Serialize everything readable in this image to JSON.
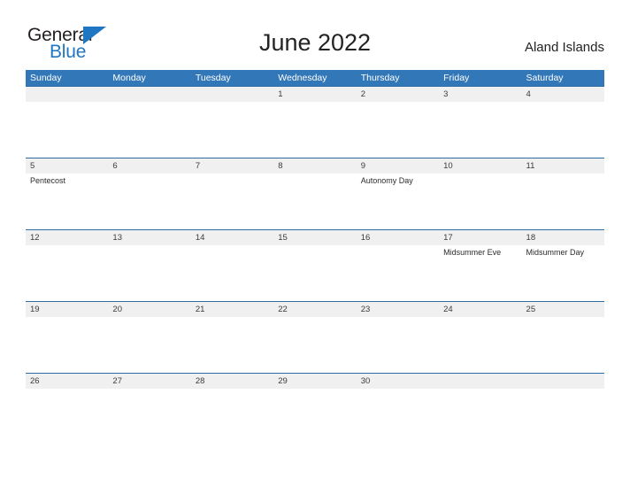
{
  "brand": {
    "name_top": "General",
    "name_bottom": "Blue",
    "accent_color": "#1f76c2"
  },
  "header": {
    "title": "June 2022",
    "locale": "Aland Islands"
  },
  "theme": {
    "header_blue": "#3277b8",
    "row_divider_blue": "#2e6da4",
    "date_band_gray": "#f0f0f0"
  },
  "calendar": {
    "weekdays": [
      "Sunday",
      "Monday",
      "Tuesday",
      "Wednesday",
      "Thursday",
      "Friday",
      "Saturday"
    ],
    "weeks": [
      {
        "days": [
          {
            "date": "",
            "event": ""
          },
          {
            "date": "",
            "event": ""
          },
          {
            "date": "",
            "event": ""
          },
          {
            "date": "1",
            "event": ""
          },
          {
            "date": "2",
            "event": ""
          },
          {
            "date": "3",
            "event": ""
          },
          {
            "date": "4",
            "event": ""
          }
        ]
      },
      {
        "days": [
          {
            "date": "5",
            "event": "Pentecost"
          },
          {
            "date": "6",
            "event": ""
          },
          {
            "date": "7",
            "event": ""
          },
          {
            "date": "8",
            "event": ""
          },
          {
            "date": "9",
            "event": "Autonomy Day"
          },
          {
            "date": "10",
            "event": ""
          },
          {
            "date": "11",
            "event": ""
          }
        ]
      },
      {
        "days": [
          {
            "date": "12",
            "event": ""
          },
          {
            "date": "13",
            "event": ""
          },
          {
            "date": "14",
            "event": ""
          },
          {
            "date": "15",
            "event": ""
          },
          {
            "date": "16",
            "event": ""
          },
          {
            "date": "17",
            "event": "Midsummer Eve"
          },
          {
            "date": "18",
            "event": "Midsummer Day"
          }
        ]
      },
      {
        "days": [
          {
            "date": "19",
            "event": ""
          },
          {
            "date": "20",
            "event": ""
          },
          {
            "date": "21",
            "event": ""
          },
          {
            "date": "22",
            "event": ""
          },
          {
            "date": "23",
            "event": ""
          },
          {
            "date": "24",
            "event": ""
          },
          {
            "date": "25",
            "event": ""
          }
        ]
      },
      {
        "days": [
          {
            "date": "26",
            "event": ""
          },
          {
            "date": "27",
            "event": ""
          },
          {
            "date": "28",
            "event": ""
          },
          {
            "date": "29",
            "event": ""
          },
          {
            "date": "30",
            "event": ""
          },
          {
            "date": "",
            "event": ""
          },
          {
            "date": "",
            "event": ""
          }
        ]
      }
    ]
  }
}
